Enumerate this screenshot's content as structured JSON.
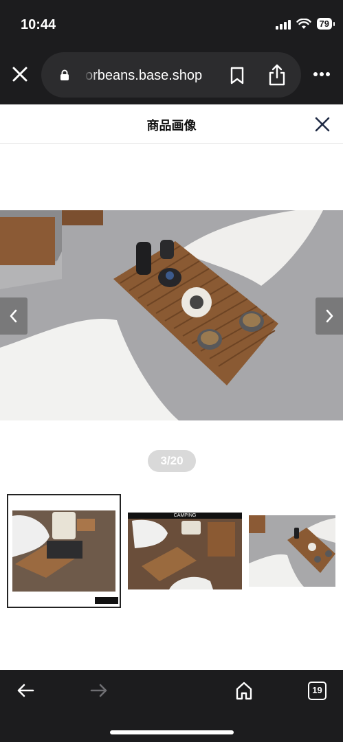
{
  "status_bar": {
    "time": "10:44",
    "battery": "79"
  },
  "browser": {
    "url": "orbeans.base.shop",
    "icons": [
      "close-icon",
      "lock-icon",
      "bookmark-icon",
      "share-icon",
      "more-icon"
    ]
  },
  "page": {
    "title": "商品画像",
    "counter": "3/20",
    "thumbnails": [
      {
        "label": "",
        "selected": true
      },
      {
        "label": "CAMPING",
        "selected": false
      },
      {
        "label": "",
        "selected": false
      }
    ]
  },
  "toolbar": {
    "icons": [
      "back-arrow-icon",
      "forward-arrow-icon",
      "home-icon",
      "tabs-icon"
    ],
    "tabs_count": "19"
  },
  "colors": {
    "chrome": "#1c1c1e",
    "pill": "#2c2c2e",
    "accent_close": "#1f2a44"
  }
}
